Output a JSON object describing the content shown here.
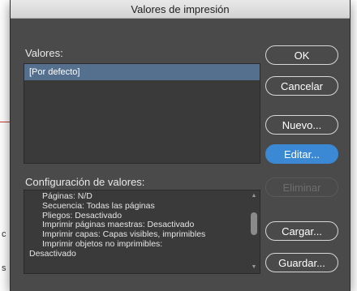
{
  "window": {
    "title": "Valores de impresión"
  },
  "presets": {
    "label": "Valores:",
    "items": [
      "[Por defecto]"
    ],
    "selected_index": 0
  },
  "details": {
    "label": "Configuración de valores:",
    "lines": [
      "Páginas: N/D",
      "Secuencia: Todas las páginas",
      "Pliegos: Desactivado",
      "Imprimir páginas maestras: Desactivado",
      "Imprimir capas: Capas visibles, imprimibles",
      "Imprimir objetos no imprimibles:",
      "Desactivado"
    ]
  },
  "buttons": {
    "ok": "OK",
    "cancel": "Cancelar",
    "new": "Nuevo...",
    "edit": "Editar...",
    "delete": "Eliminar",
    "load": "Cargar...",
    "save": "Guardar..."
  },
  "colors": {
    "dialog_bg": "#4a4a4a",
    "selection": "#55708f",
    "primary_button": "#3b89d4"
  }
}
